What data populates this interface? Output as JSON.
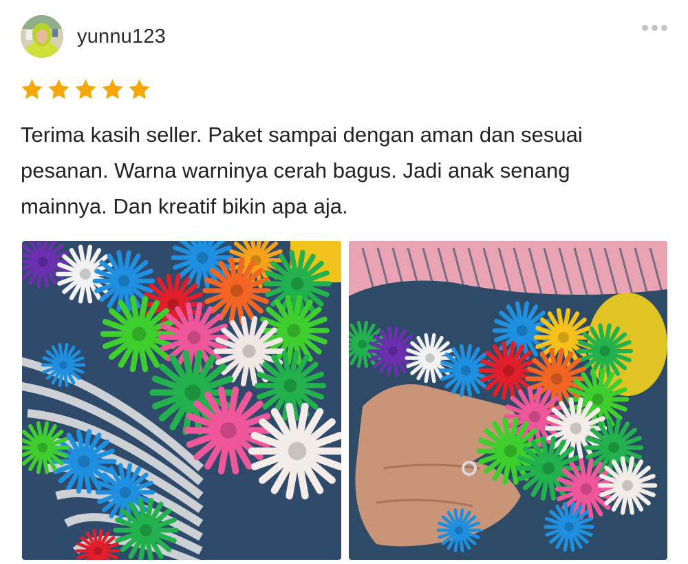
{
  "review": {
    "username": "yunnu123",
    "avatar_icon": "user-avatar-icon",
    "rating": 5,
    "rating_max": 5,
    "star_color": "#F6A700",
    "comment": "Terima kasih seller. Paket sampai dengan aman dan sesuai pesanan. Warna warninya cerah bagus. Jadi anak senang mainnya. Dan kreatif bikin apa aja.",
    "more_icon": "more-horizontal-icon",
    "photos": [
      {
        "icon": "gear-blocks-photo"
      },
      {
        "icon": "gear-blocks-in-hand-photo"
      }
    ]
  }
}
